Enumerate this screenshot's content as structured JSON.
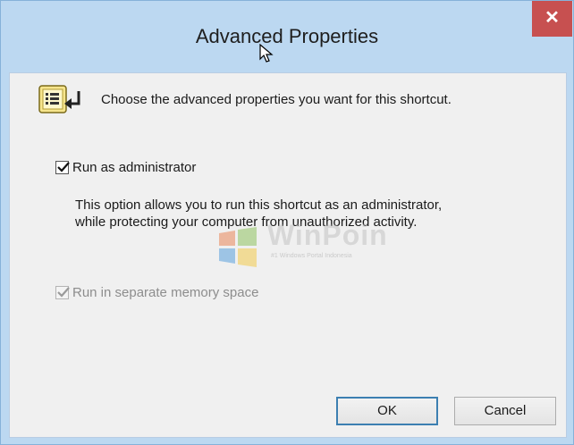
{
  "window": {
    "title": "Advanced Properties",
    "close_label": "✕"
  },
  "header": {
    "text": "Choose the advanced properties you want for this shortcut."
  },
  "options": {
    "run_as_admin": {
      "label": "Run as administrator",
      "checked": true,
      "enabled": true,
      "description": "This option allows you to run this shortcut as an administrator, while protecting your computer from unauthorized activity."
    },
    "separate_memory": {
      "label": "Run in separate memory space",
      "checked": true,
      "enabled": false
    }
  },
  "buttons": {
    "ok": "OK",
    "cancel": "Cancel"
  },
  "watermark": {
    "name": "WinPoin",
    "tagline": "#1 Windows Portal Indonesia"
  },
  "colors": {
    "titlebar": "#bcd8f1",
    "close": "#c75050",
    "client": "#f0f0f0",
    "ok_border": "#3c7fb1"
  }
}
